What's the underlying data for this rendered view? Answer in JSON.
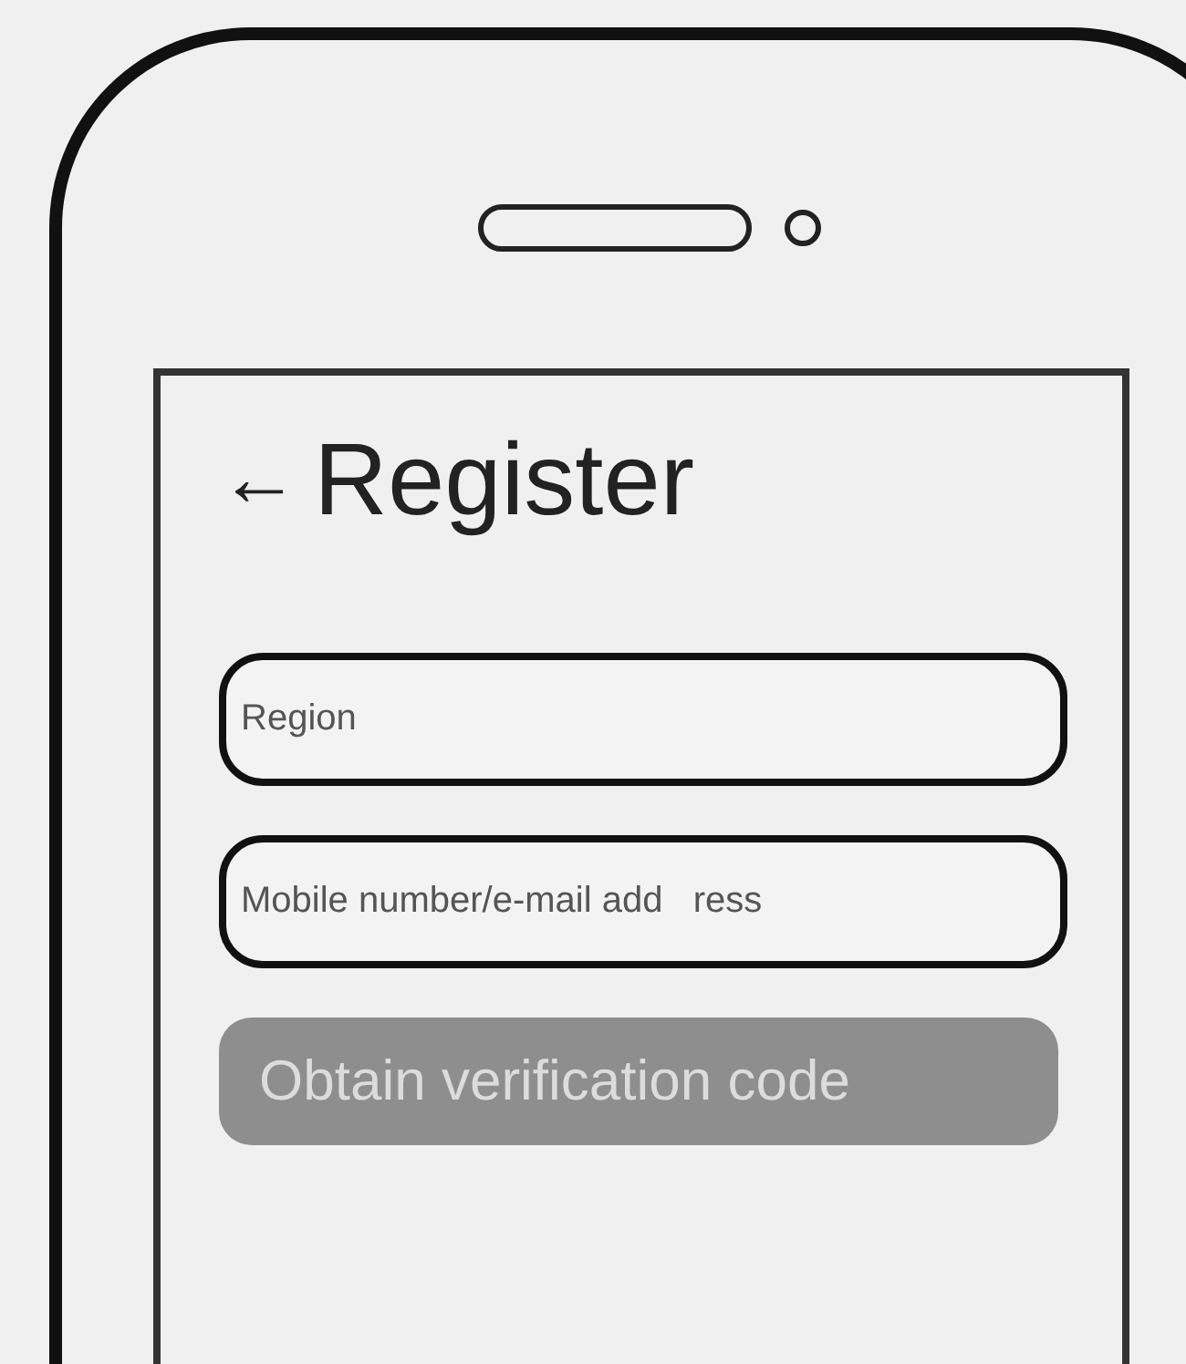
{
  "header": {
    "back_icon": "←",
    "title": "Register"
  },
  "fields": [
    {
      "placeholder": "Region"
    },
    {
      "placeholder": "Mobile number/e-mail add   ress"
    }
  ],
  "button": {
    "label": "Obtain verification code",
    "disabled": true
  }
}
